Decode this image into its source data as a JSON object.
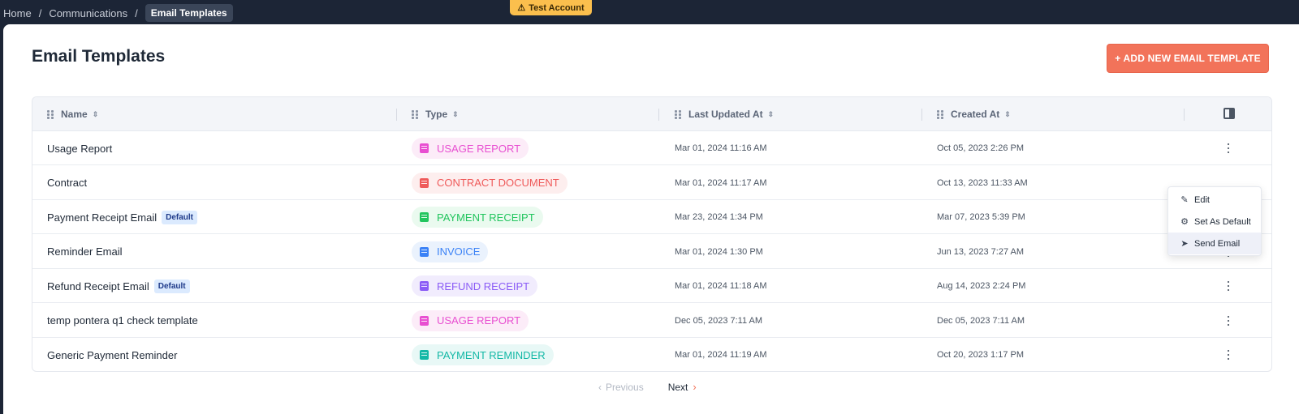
{
  "breadcrumb": {
    "items": [
      "Home",
      "Communications"
    ],
    "current": "Email Templates"
  },
  "test_badge": {
    "icon": "warning-triangle-icon",
    "label": "Test Account"
  },
  "page": {
    "title": "Email Templates",
    "add_button": "+ ADD NEW EMAIL TEMPLATE"
  },
  "table": {
    "headers": [
      "Name",
      "Type",
      "Last Updated At",
      "Created At"
    ],
    "rows": [
      {
        "name": "Usage Report",
        "default": "",
        "type": "USAGE REPORT",
        "type_color": "#e84fd1",
        "type_bg": "#fcecf8",
        "updated": "Mar 01, 2024 11:16 AM",
        "created": "Oct 05, 2023 2:26 PM"
      },
      {
        "name": "Contract",
        "default": "",
        "type": "CONTRACT DOCUMENT",
        "type_color": "#ef5a5a",
        "type_bg": "#fdeeee",
        "updated": "Mar 01, 2024 11:17 AM",
        "created": "Oct 13, 2023 11:33 AM"
      },
      {
        "name": "Payment Receipt Email",
        "default": "Default",
        "type": "PAYMENT RECEIPT",
        "type_color": "#22c55e",
        "type_bg": "#eafaef",
        "updated": "Mar 23, 2024 1:34 PM",
        "created": "Mar 07, 2023 5:39 PM"
      },
      {
        "name": "Reminder Email",
        "default": "",
        "type": "INVOICE",
        "type_color": "#3b82f6",
        "type_bg": "#eaf2fd",
        "updated": "Mar 01, 2024 1:30 PM",
        "created": "Jun 13, 2023 7:27 AM"
      },
      {
        "name": "Refund Receipt Email",
        "default": "Default",
        "type": "REFUND RECEIPT",
        "type_color": "#8b5cf6",
        "type_bg": "#f1ecfd",
        "updated": "Mar 01, 2024 11:18 AM",
        "created": "Aug 14, 2023 2:24 PM"
      },
      {
        "name": "temp pontera q1 check template",
        "default": "",
        "type": "USAGE REPORT",
        "type_color": "#e84fd1",
        "type_bg": "#fcecf8",
        "updated": "Dec 05, 2023 7:11 AM",
        "created": "Dec 05, 2023 7:11 AM"
      },
      {
        "name": "Generic Payment Reminder",
        "default": "",
        "type": "PAYMENT REMINDER",
        "type_color": "#14b8a6",
        "type_bg": "#e8f8f6",
        "updated": "Mar 01, 2024 11:19 AM",
        "created": "Oct 20, 2023 1:17 PM"
      }
    ]
  },
  "row_menu": {
    "items": [
      {
        "label": "Edit",
        "icon": "pencil-icon"
      },
      {
        "label": "Set As Default",
        "icon": "gear-icon"
      },
      {
        "label": "Send Email",
        "icon": "send-icon"
      }
    ]
  },
  "pagination": {
    "previous": "Previous",
    "next": "Next"
  }
}
